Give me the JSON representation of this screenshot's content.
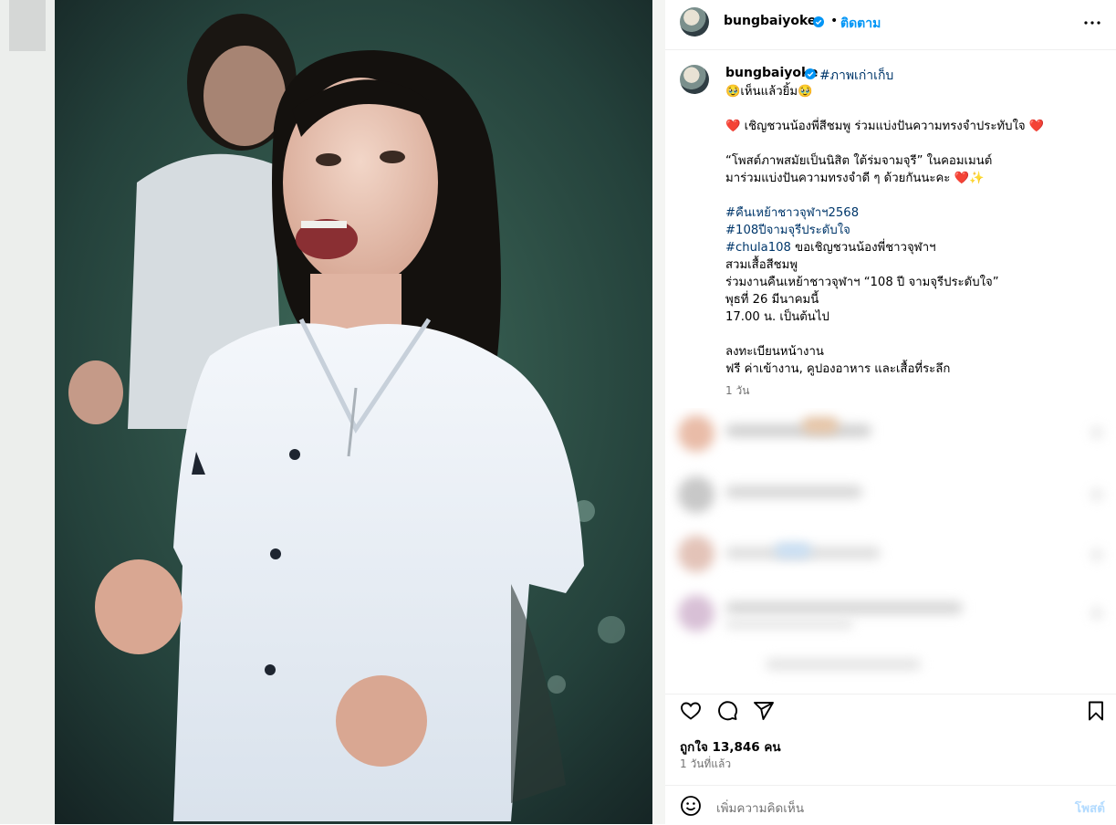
{
  "post": {
    "username": "bungbaiyoke",
    "separator": "•",
    "follow_label": "ติดตาม",
    "caption_tag": "#ภาพเก่าเก็บ",
    "caption_lines": [
      "🥹เห็นแล้วยิ้ม🥹",
      "",
      "เชิญชวนน้องพี่สีชมพู ร่วมแบ่งปันความทรงจำประทับใจ",
      "",
      "“โพสต์ภาพสมัยเป็นนิสิต ใต้ร่มจามจุรี” ในคอมเมนต์",
      "มาร่วมแบ่งปันความทรงจำดี ๆ ด้วยกันนะคะ",
      "",
      "#คืนเหย้าชาวจุฬาฯ2568",
      "#108ปีจามจุรีประดับใจ",
      "#chula108",
      "สวมเสื้อสีชมพู",
      "ร่วมงานคืนเหย้าชาวจุฬาฯ “108 ปี จามจุรีประดับใจ”",
      "พุธที่ 26 มีนาคมนี้",
      "17.00 น. เป็นต้นไป",
      "",
      "ลงทะเบียนหน้างาน",
      "ฟรี ค่าเข้างาน, คูปองอาหาร และเสื้อที่ระลึก"
    ],
    "chula108_suffix": " ขอเชิญชวนน้องพี่ชาวจุฬาฯ",
    "caption_age": "1 วัน",
    "likes": "ถูกใจ 13,846 คน",
    "posted": "1 วันที่แล้ว",
    "comment_placeholder": "เพิ่มความคิดเห็น",
    "post_label": "โพสต์"
  },
  "icons": {
    "verified": "verified-badge-icon",
    "more": "more-options-icon",
    "like": "heart-icon",
    "comment": "comment-icon",
    "share": "share-icon",
    "save": "bookmark-icon",
    "emoji": "emoji-icon"
  },
  "colors": {
    "link": "#00376b",
    "follow": "#0095f6",
    "verified": "#0095f6",
    "muted": "#737373",
    "heart_emoji": "#e0334a"
  }
}
